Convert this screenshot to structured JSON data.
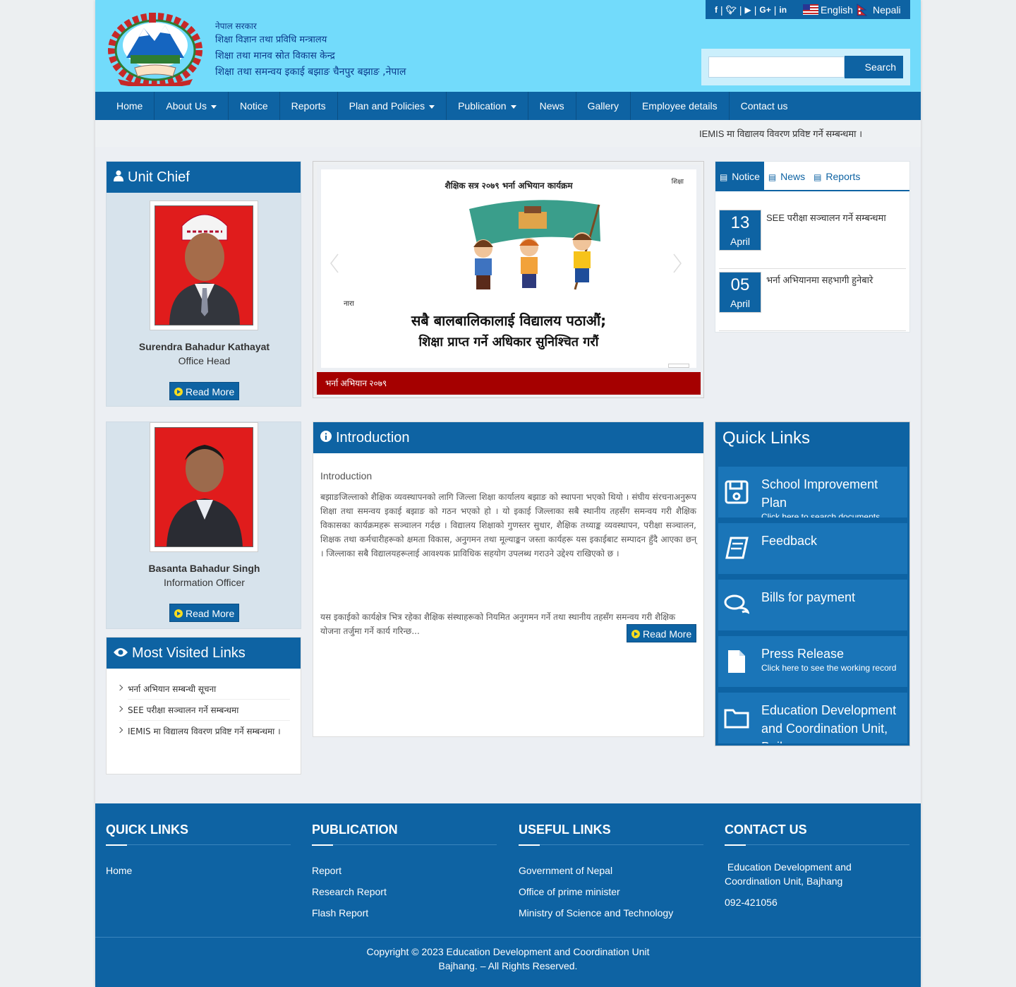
{
  "header": {
    "gov_line1": "नेपाल सरकार",
    "gov_line2": "शिक्षा विज्ञान तथा प्रविधि मन्त्रालय",
    "gov_line3": "शिक्षा तथा मानव स्रोत विकास केन्द्र",
    "gov_line4": "शिक्षा तथा समन्वय इकाई बझाङ चैनपुर बझाङ ,नेपाल",
    "lang_english": "English",
    "lang_nepali": "Nepali",
    "search_placeholder": "",
    "search_button": "Search",
    "social_icons": [
      "facebook-icon",
      "twitter-icon",
      "youtube-icon",
      "google-plus-icon",
      "linkedin-icon"
    ]
  },
  "nav": {
    "items": [
      "Home",
      "About Us",
      "Notice",
      "Reports",
      "Plan and Policies",
      "Publication",
      "News",
      "Gallery",
      "Employee details",
      "Contact us"
    ]
  },
  "ticker": {
    "text": "IEMIS मा विद्यालय विवरण प्रविष्ट गर्ने सम्बन्धमा ।"
  },
  "unit_chief": {
    "title": "Unit Chief",
    "name": "Surendra Bahadur Kathayat",
    "role": "Office Head",
    "read_more": "Read More"
  },
  "officer": {
    "name": "Basanta Bahadur Singh",
    "role": "Information Officer",
    "read_more": "Read More"
  },
  "slider": {
    "caption": "भर्ना अभियान २०७९",
    "slide_title": "शैक्षिक सत्र २०७९ भर्ना अभियान कार्यक्रम",
    "slide_tag": "शिक्षा",
    "slide_slogan_label": "नारा",
    "slide_slogan_1": "सबै बालबालिकालाई विद्यालय पठाऔं;",
    "slide_slogan_2": "शिक्षा प्राप्त गर्ने अधिकार सुनिश्चित गरौं"
  },
  "tabs": {
    "notice": "Notice",
    "news": "News",
    "reports": "Reports",
    "items": [
      {
        "day": "13",
        "month": "April",
        "title": "SEE परीक्षा सञ्चालन गर्ने सम्बन्धमा"
      },
      {
        "day": "05",
        "month": "April",
        "title": "भर्ना अभियानमा सहभागी हुनेबारे"
      }
    ]
  },
  "intro": {
    "title": "Introduction",
    "subtitle": "Introduction",
    "para1": "बझाङजिल्लाको शैक्षिक व्यवस्थापनको लागि जिल्ला शिक्षा कार्यालय बझाङ को स्थापना भएको थियो । संघीय संरचनाअनुरूप शिक्षा तथा समन्वय इकाई बझाङ को गठन भएको हो । यो इकाई जिल्लाका सबै स्थानीय तहसँग समन्वय गरी शैक्षिक विकासका कार्यक्रमहरू सञ्चालन गर्दछ । विद्यालय शिक्षाको गुणस्तर सुधार, शैक्षिक तथ्याङ्क व्यवस्थापन, परीक्षा सञ्चालन, शिक्षक तथा कर्मचारीहरूको क्षमता विकास, अनुगमन तथा मूल्याङ्कन जस्ता कार्यहरू यस इकाईबाट सम्पादन हुँदै आएका छन् । जिल्लाका सबै विद्यालयहरूलाई आवश्यक प्राविधिक सहयोग उपलब्ध गराउने उद्देश्य राखिएको छ ।",
    "para2": "यस इकाईको कार्यक्षेत्र भित्र रहेका शैक्षिक संस्थाहरूको नियमित अनुगमन गर्ने तथा स्थानीय तहसँग समन्वय गरी शैक्षिक योजना तर्जुमा गर्ने कार्य गरिन्छ...",
    "read_more": "Read More"
  },
  "most_visited": {
    "title": "Most Visited Links",
    "items": [
      "भर्ना अभियान सम्बन्धी सूचना",
      "SEE परीक्षा सञ्चालन गर्ने सम्बन्धमा",
      "IEMIS मा विद्यालय विवरण प्रविष्ट गर्ने सम्बन्धमा ।"
    ]
  },
  "quick_links": {
    "title": "Quick Links",
    "items": [
      {
        "title": "School Improvement Plan",
        "sub": "Click here to search documents",
        "icon": "save-icon"
      },
      {
        "title": "Feedback",
        "sub": "",
        "icon": "book-icon"
      },
      {
        "title": "Bills for payment",
        "sub": "",
        "icon": "comments-icon"
      },
      {
        "title": "Press Release",
        "sub": "Click here to see the working record",
        "icon": "file-icon"
      },
      {
        "title": "Education Development and Coordination Unit, Bajhang",
        "sub": "",
        "icon": "folder-icon"
      }
    ]
  },
  "footer": {
    "quick_links_title": "QUICK LINKS",
    "quick_links": [
      "Home"
    ],
    "publication_title": "PUBLICATION",
    "publication": [
      "Report",
      "Research Report",
      "Flash Report"
    ],
    "useful_title": "USEFUL LINKS",
    "useful": [
      "Government of Nepal",
      "Office of prime minister",
      "Ministry of Science and Technology"
    ],
    "contact_title": "CONTACT US",
    "contact_org": " Education Development and Coordination Unit, Bajhang",
    "contact_phone": "092-421056",
    "copyright_1": "Copyright © 2023 Education Development and Coordination Unit",
    "copyright_2": "Bajhang. – All Rights Reserved."
  },
  "colors": {
    "header_bg": "#72dbfb",
    "primary": "#0e63a3",
    "caption_red": "#a50000",
    "gov_text": "#0b3a8c"
  }
}
